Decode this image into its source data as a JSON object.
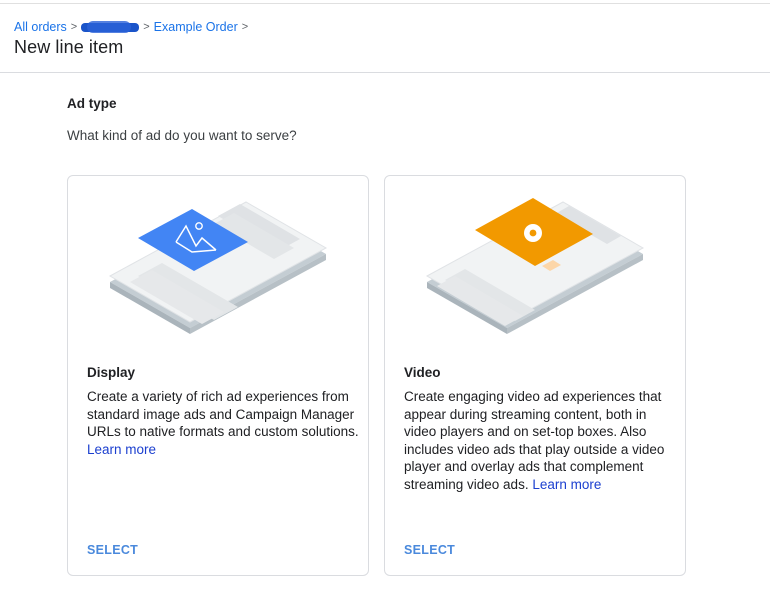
{
  "breadcrumb": {
    "all_orders": "All orders",
    "separator": ">",
    "current_order": "Example Order"
  },
  "page_title": "New line item",
  "section": {
    "title": "Ad type",
    "question": "What kind of ad do you want to serve?"
  },
  "cards": [
    {
      "title": "Display",
      "description": "Create a variety of rich ad experiences from standard image ads and Campaign Manager URLs to native formats and custom solutions.",
      "learn_more": "Learn more",
      "select": "SELECT",
      "accent_color": "#4285f4"
    },
    {
      "title": "Video",
      "description": "Create engaging video ad experiences that appear during streaming content, both in video players and on set-top boxes. Also includes video ads that play outside a video player and overlay ads that complement streaming video ads.",
      "learn_more": "Learn more",
      "select": "SELECT",
      "accent_color": "#f29900"
    }
  ],
  "colors": {
    "link": "#1a73e8",
    "select": "#4a89dc",
    "border": "#dadce0"
  }
}
